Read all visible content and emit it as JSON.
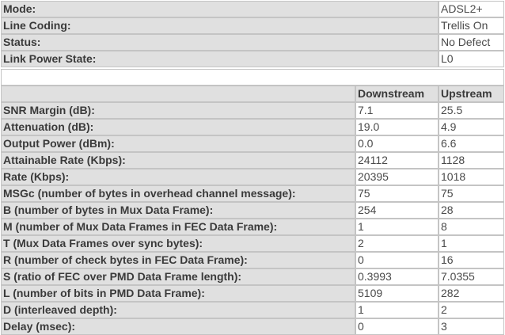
{
  "status": [
    {
      "label": "Mode:",
      "value": "ADSL2+"
    },
    {
      "label": "Line Coding:",
      "value": "Trellis On"
    },
    {
      "label": "Status:",
      "value": "No Defect"
    },
    {
      "label": "Link Power State:",
      "value": "L0"
    }
  ],
  "stats": {
    "headers": {
      "downstream": "Downstream",
      "upstream": "Upstream"
    },
    "rows": [
      {
        "label": "SNR Margin (dB):",
        "down": "7.1",
        "up": "25.5"
      },
      {
        "label": "Attenuation (dB):",
        "down": "19.0",
        "up": "4.9"
      },
      {
        "label": "Output Power (dBm):",
        "down": "0.0",
        "up": "6.6"
      },
      {
        "label": "Attainable Rate (Kbps):",
        "down": "24112",
        "up": "1128"
      },
      {
        "label": "Rate (Kbps):",
        "down": "20395",
        "up": "1018"
      },
      {
        "label": "MSGc (number of bytes in overhead channel message):",
        "down": "75",
        "up": "75"
      },
      {
        "label": "B (number of bytes in Mux Data Frame):",
        "down": "254",
        "up": "28"
      },
      {
        "label": "M (number of Mux Data Frames in FEC Data Frame):",
        "down": "1",
        "up": "8"
      },
      {
        "label": "T (Mux Data Frames over sync bytes):",
        "down": "2",
        "up": "1"
      },
      {
        "label": "R (number of check bytes in FEC Data Frame):",
        "down": "0",
        "up": "16"
      },
      {
        "label": "S (ratio of FEC over PMD Data Frame length):",
        "down": "0.3993",
        "up": "7.0355"
      },
      {
        "label": "L (number of bits in PMD Data Frame):",
        "down": "5109",
        "up": "282"
      },
      {
        "label": "D (interleaved depth):",
        "down": "1",
        "up": "2"
      },
      {
        "label": "Delay (msec):",
        "down": "0",
        "up": "3"
      }
    ]
  }
}
